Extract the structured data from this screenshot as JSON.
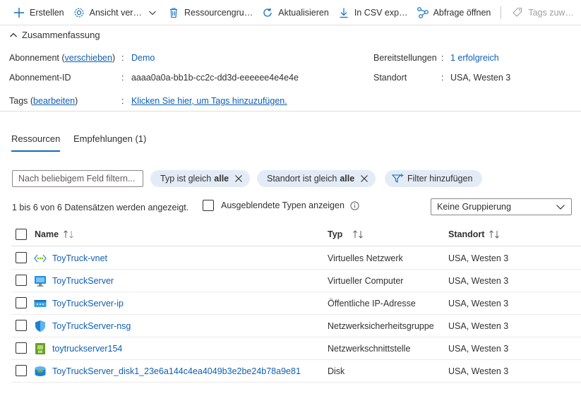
{
  "toolbar": {
    "create": "Erstellen",
    "view": "Ansicht ver…",
    "resource_group": "Ressourcengru…",
    "refresh": "Aktualisieren",
    "csv": "In CSV exp…",
    "query": "Abfrage öffnen",
    "tags": "Tags zuw…"
  },
  "essentials": {
    "title": "Zusammenfassung",
    "subscription_label_pre": "Abonnement (",
    "subscription_move": "verschieben",
    "subscription_label_post": ")",
    "subscription_value": "Demo",
    "subscription_id_label": "Abonnement-ID",
    "subscription_id_value": "aaaa0a0a-bb1b-cc2c-dd3d-eeeeee4e4e4e",
    "tags_label_pre": "Tags (",
    "tags_edit": "bearbeiten",
    "tags_label_post": ")",
    "tags_value": "Klicken Sie hier, um Tags hinzuzufügen.",
    "deployments_label": "Bereitstellungen",
    "deployments_value": "1 erfolgreich",
    "location_label": "Standort",
    "location_value": "USA, Westen 3",
    "colon": ":"
  },
  "tabs": {
    "resources": "Ressourcen",
    "recommendations": "Empfehlungen (1)"
  },
  "filters": {
    "placeholder": "Nach beliebigem Feld filtern...",
    "type_pill_text": "Typ ist gleich",
    "type_pill_value": "alle",
    "location_pill_text": "Standort ist gleich",
    "location_pill_value": "alle",
    "add_filter": "Filter hinzufügen"
  },
  "summary": {
    "count_text": "1 bis 6 von 6 Datensätzen werden angezeigt.",
    "show_hidden": "Ausgeblendete Typen anzeigen",
    "grouping": "Keine Gruppierung"
  },
  "table": {
    "headers": {
      "name": "Name",
      "type": "Typ",
      "location": "Standort"
    },
    "rows": [
      {
        "name": "ToyTruck-vnet",
        "type": "Virtuelles Netzwerk",
        "location": "USA, Westen 3",
        "icon": "vnet-icon"
      },
      {
        "name": "ToyTruckServer",
        "type": "Virtueller Computer",
        "location": "USA, Westen 3",
        "icon": "virtual-machine-icon"
      },
      {
        "name": "ToyTruckServer-ip",
        "type": "Öffentliche IP-Adresse",
        "location": "USA, Westen 3",
        "icon": "public-ip-icon"
      },
      {
        "name": "ToyTruckServer-nsg",
        "type": "Netzwerksicherheitsgruppe",
        "location": "USA, Westen 3",
        "icon": "nsg-shield-icon"
      },
      {
        "name": "toytruckserver154",
        "type": "Netzwerkschnittstelle",
        "location": "USA, Westen 3",
        "icon": "network-interface-icon"
      },
      {
        "name": "ToyTruckServer_disk1_23e6a144c4ea4049b3e2be24b78a9e81",
        "type": "Disk",
        "location": "USA, Westen 3",
        "icon": "disk-icon"
      }
    ]
  },
  "colors": {
    "accent": "#0f6cbd",
    "link": "#0f5fb5",
    "pill_bg": "#e3ecf6"
  }
}
